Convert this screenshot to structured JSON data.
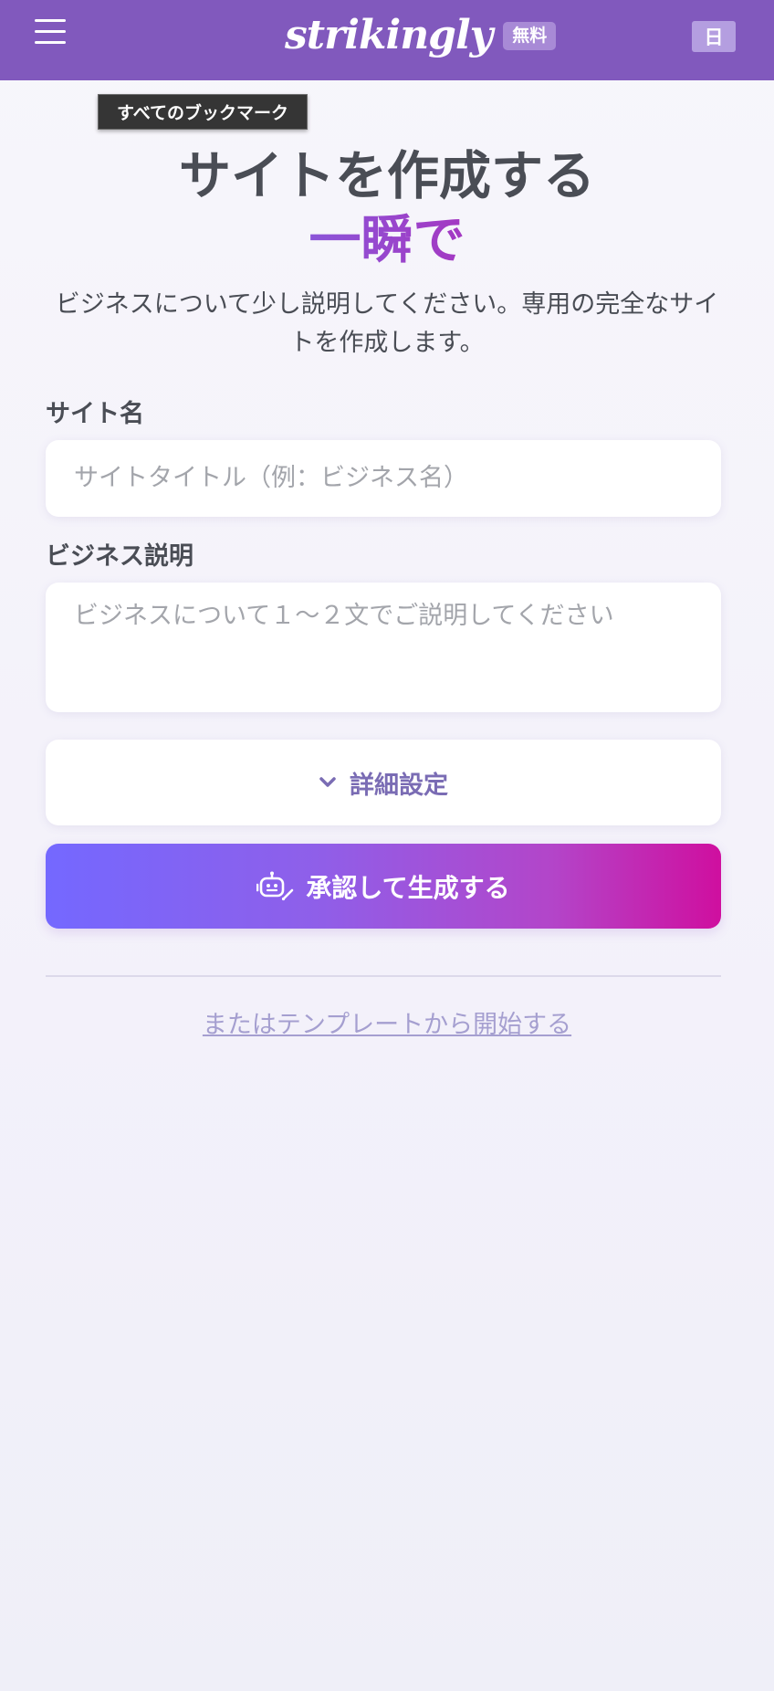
{
  "header": {
    "logo_text": "strikingly",
    "plan_badge": "無料",
    "language_label": "日",
    "background_color": "#8159bd"
  },
  "tooltip": {
    "text": "すべてのブックマーク"
  },
  "hero": {
    "title_line1": "サイトを作成する",
    "title_line2": "一瞬で",
    "subtitle": "ビジネスについて少し説明してください。専用の完全なサイトを作成します。"
  },
  "form": {
    "site_name": {
      "label": "サイト名",
      "value": "",
      "placeholder": "サイトタイトル（例：ビジネス名）"
    },
    "business_description": {
      "label": "ビジネス説明",
      "value": "",
      "placeholder": "ビジネスについて１〜２文でご説明してください"
    },
    "advanced_settings_label": "詳細設定",
    "generate_button_label": "承認して生成する"
  },
  "alternative": {
    "template_link_text": "またはテンプレートから開始する"
  },
  "colors": {
    "accent_purple": "#8159bd",
    "gradient_start": "#7468ff",
    "gradient_end": "#cf0f9f",
    "link_color": "#a59fd0"
  },
  "icons": {
    "menu": "hamburger-menu-icon",
    "advanced": "chevron-down-icon",
    "generate": "robot-ai-icon"
  }
}
